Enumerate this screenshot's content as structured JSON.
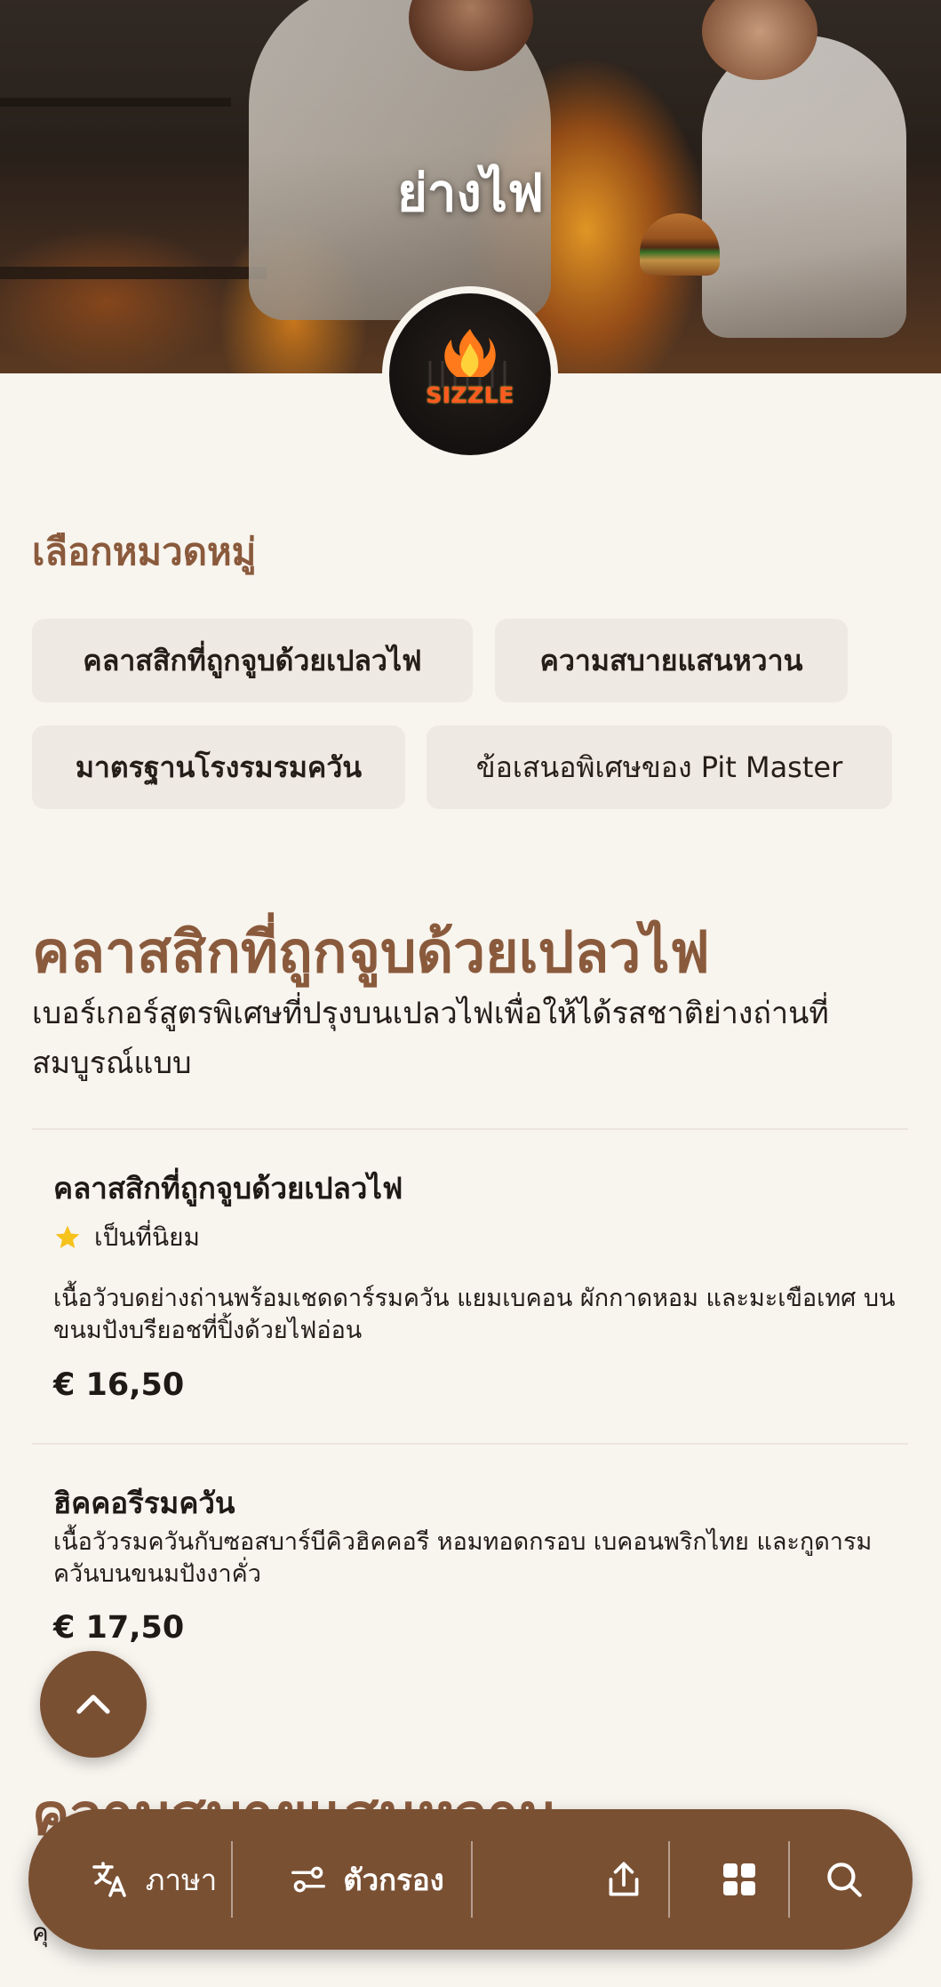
{
  "hero": {
    "title": "ย่างไฟ",
    "logo_text": "SIZZLE"
  },
  "category_picker": {
    "heading": "เลือกหมวดหมู่",
    "chips": [
      "คลาสสิกที่ถูกจูบด้วยเปลวไฟ",
      "ความสบายแสนหวาน",
      "มาตรฐานโรงรมรมควัน",
      "ข้อเสนอพิเศษของ Pit Master"
    ]
  },
  "section": {
    "title": "คลาสสิกที่ถูกจูบด้วยเปลวไฟ",
    "description": "เบอร์เกอร์สูตรพิเศษที่ปรุงบนเปลวไฟเพื่อให้ได้รสชาติย่างถ่านที่สมบูรณ์แบบ",
    "items": [
      {
        "name": "คลาสสิกที่ถูกจูบด้วยเปลวไฟ",
        "badge": "เป็นที่นิยม",
        "description": "เนื้อวัวบดย่างถ่านพร้อมเชดดาร์รมควัน แยมเบคอน ผักกาดหอม และมะเขือเทศ บนขนมปังบรียอชที่ปิ้งด้วยไฟอ่อน",
        "price": "€ 16,50"
      },
      {
        "name": "ฮิคคอรีรมควัน",
        "description": "เนื้อวัวรมควันกับซอสบาร์บีคิวฮิคคอรี หอมทอดกรอบ เบคอนพริกไทย และกูดารมควันบนขนมปังงาคั่ว",
        "price": "€ 17,50"
      }
    ]
  },
  "next_section": {
    "title": "ความสบายแสนหวาน",
    "partial_text": "คุ"
  },
  "bottom_bar": {
    "language_label": "ภาษา",
    "filter_label": "ตัวกรอง"
  },
  "colors": {
    "accent_brown": "#7a5033",
    "heading_brown": "#8a5a3c",
    "background": "#f8f4ee",
    "chip_background": "#efe9e3",
    "star": "#f6c21c"
  },
  "icons": [
    "translate-icon",
    "filter-sliders-icon",
    "share-icon",
    "grid-icon",
    "search-icon",
    "chevron-up-icon",
    "star-icon",
    "flame-icon"
  ]
}
